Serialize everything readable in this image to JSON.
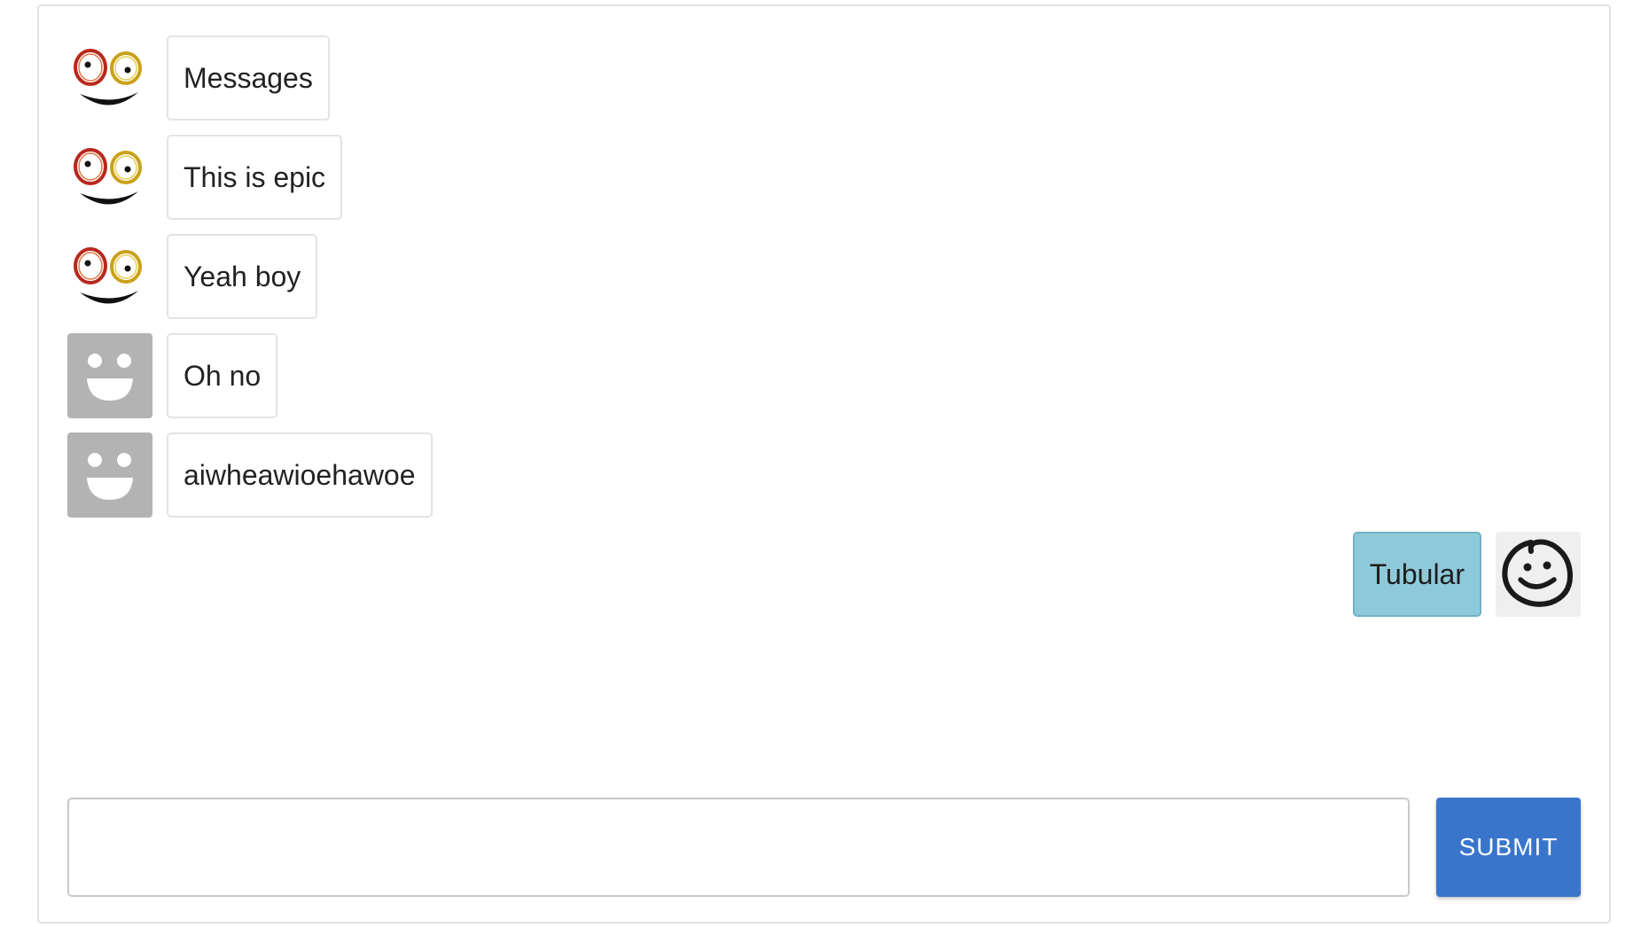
{
  "messages": [
    {
      "text": "Messages",
      "avatar": "googly-eyes-smile-icon",
      "side": "incoming"
    },
    {
      "text": "This is epic",
      "avatar": "googly-eyes-smile-icon",
      "side": "incoming"
    },
    {
      "text": "Yeah boy",
      "avatar": "googly-eyes-smile-icon",
      "side": "incoming"
    },
    {
      "text": "Oh no",
      "avatar": "gray-smiley-icon",
      "side": "incoming"
    },
    {
      "text": "aiwheawioehawoe",
      "avatar": "gray-smiley-icon",
      "side": "incoming"
    },
    {
      "text": "Tubular",
      "avatar": "doodle-smiley-icon",
      "side": "outgoing"
    }
  ],
  "composer": {
    "input_value": "",
    "input_placeholder": "",
    "submit_label": "SUBMIT"
  },
  "colors": {
    "submit_bg": "#3a75cc",
    "outgoing_bubble_bg": "#8ec9da",
    "gray_avatar_bg": "#b3b3b3"
  }
}
